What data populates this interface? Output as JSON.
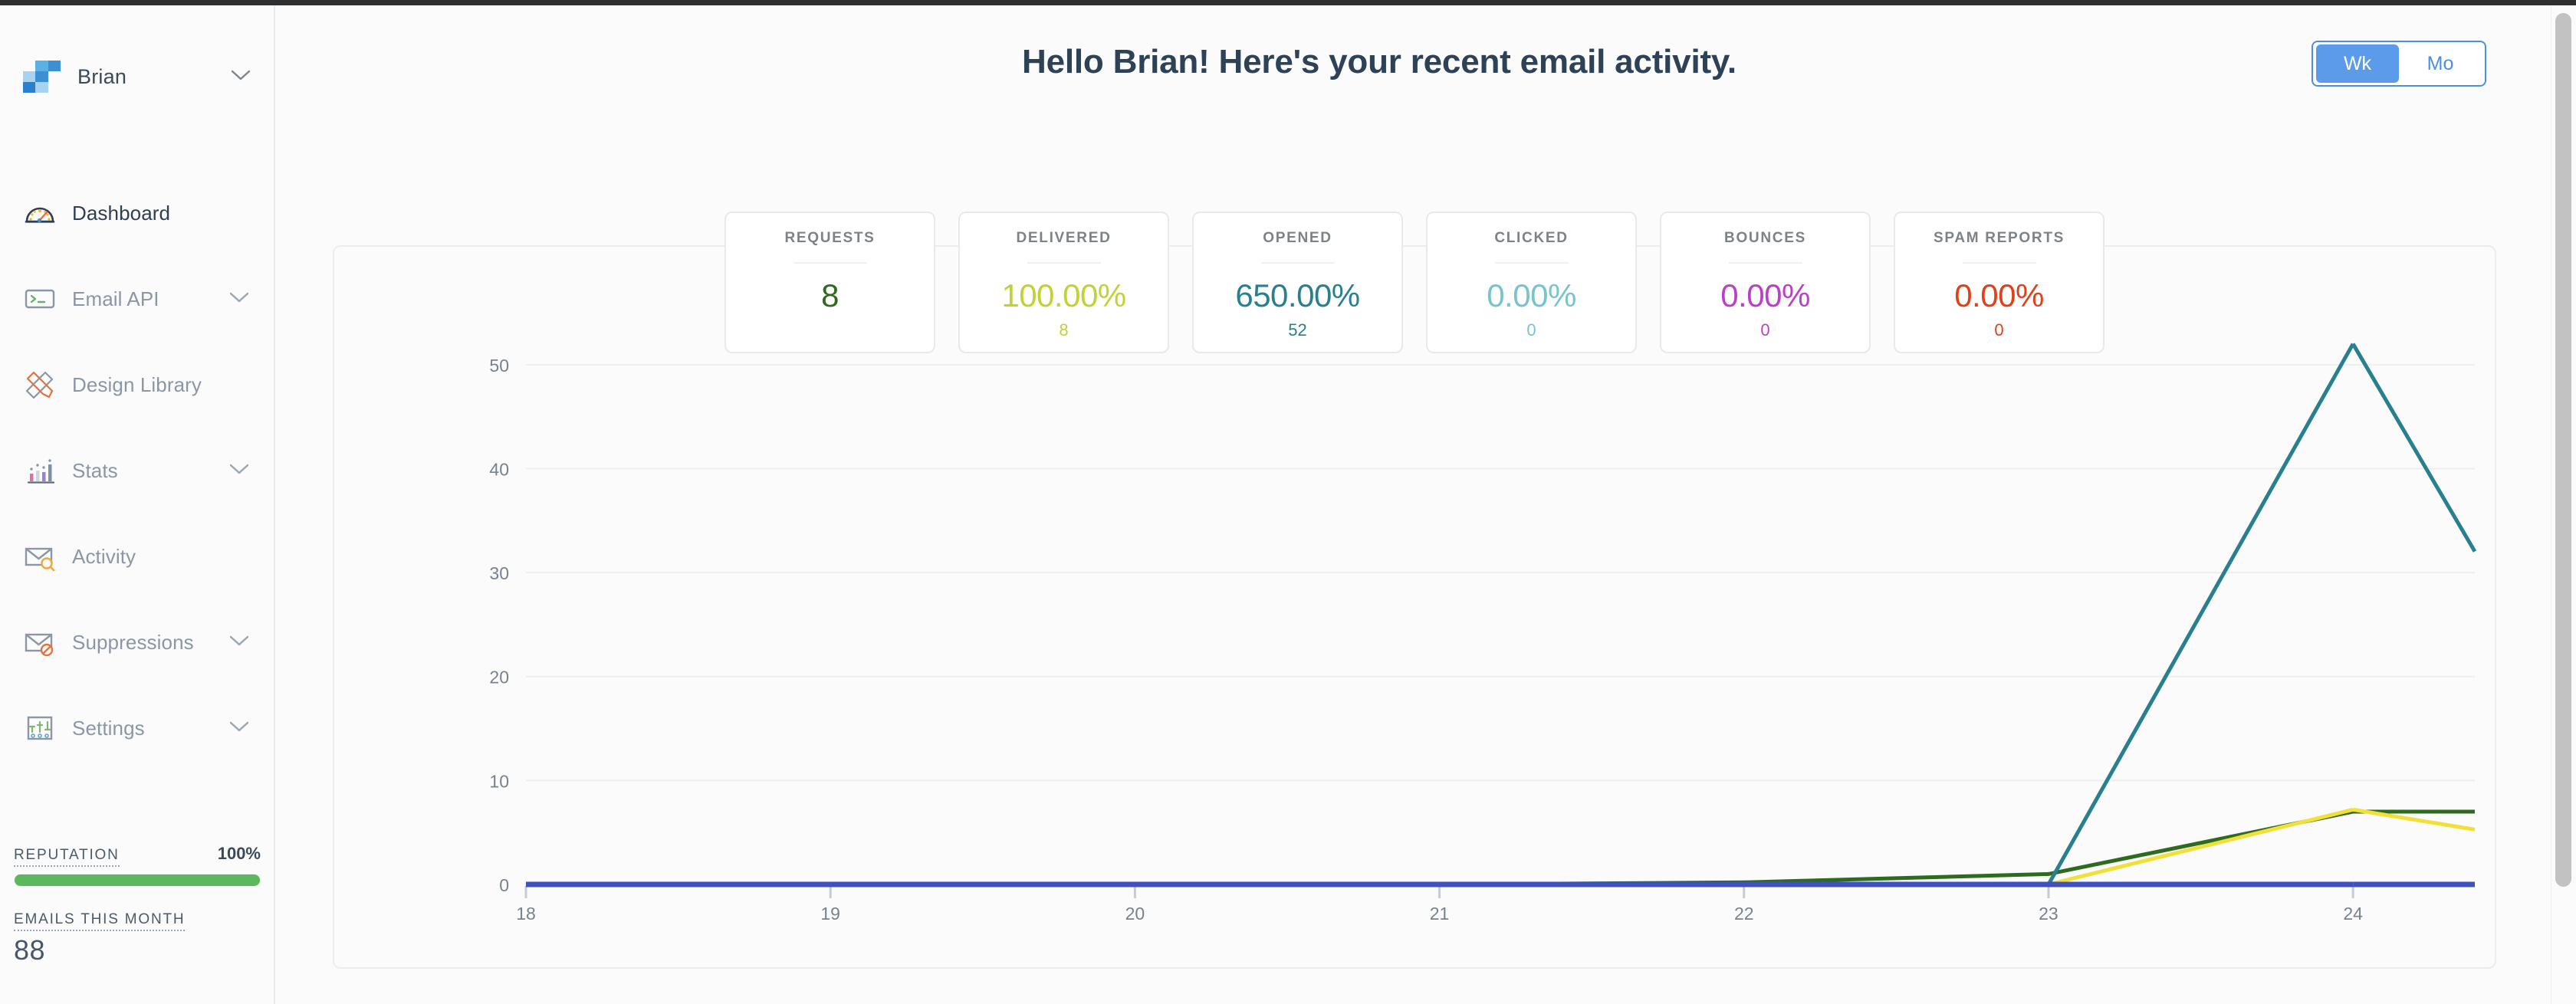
{
  "brand": {
    "name": "Brian",
    "logo_icon": "sendgrid-logo-icon",
    "caret_icon": "chevron-down-icon"
  },
  "sidebar": {
    "items": [
      {
        "label": "Dashboard",
        "icon": "speedometer-icon",
        "active": true,
        "caret": false
      },
      {
        "label": "Email API",
        "icon": "terminal-card-icon",
        "active": false,
        "caret": true
      },
      {
        "label": "Design Library",
        "icon": "ruler-pencil-icon",
        "active": false,
        "caret": false
      },
      {
        "label": "Stats",
        "icon": "bar-chart-icon",
        "active": false,
        "caret": true
      },
      {
        "label": "Activity",
        "icon": "envelope-search-icon",
        "active": false,
        "caret": false
      },
      {
        "label": "Suppressions",
        "icon": "envelope-block-icon",
        "active": false,
        "caret": true
      },
      {
        "label": "Settings",
        "icon": "sliders-icon",
        "active": false,
        "caret": true
      }
    ],
    "reputation": {
      "label": "REPUTATION",
      "value": "100%",
      "percent": 100,
      "bar_color": "#5cb85c"
    },
    "emails_this_month": {
      "label": "EMAILS THIS MONTH",
      "value": "88"
    }
  },
  "header": {
    "title": "Hello Brian! Here's your recent email activity.",
    "range_toggle": {
      "options": [
        {
          "label": "Wk",
          "active": true
        },
        {
          "label": "Mo",
          "active": false
        }
      ],
      "accent": "#4a90e2"
    }
  },
  "metrics": [
    {
      "title": "REQUESTS",
      "main": "8",
      "sub": "",
      "color": "#2f6b1e"
    },
    {
      "title": "DELIVERED",
      "main": "100.00%",
      "sub": "8",
      "color": "#c2d135"
    },
    {
      "title": "OPENED",
      "main": "650.00%",
      "sub": "52",
      "color": "#28808f"
    },
    {
      "title": "CLICKED",
      "main": "0.00%",
      "sub": "0",
      "color": "#78c3cd"
    },
    {
      "title": "BOUNCES",
      "main": "0.00%",
      "sub": "0",
      "color": "#bb3fc9"
    },
    {
      "title": "SPAM REPORTS",
      "main": "0.00%",
      "sub": "0",
      "color": "#e0401a"
    }
  ],
  "chart_data": {
    "type": "line",
    "title": "",
    "xlabel": "",
    "ylabel": "",
    "x": [
      18,
      19,
      20,
      21,
      22,
      23,
      24
    ],
    "xticklabels": [
      "18",
      "19",
      "20",
      "21",
      "22",
      "23",
      "24"
    ],
    "yticklabels": [
      "0",
      "10",
      "20",
      "30",
      "40",
      "50"
    ],
    "ylim": [
      0,
      55
    ],
    "xlim": [
      18,
      24.4
    ],
    "grid": true,
    "legend": "none",
    "series": [
      {
        "name": "Requests",
        "color": "#2f6b1e",
        "values": [
          0,
          0,
          0,
          0,
          0.2,
          1.0,
          7.0
        ]
      },
      {
        "name": "Delivered",
        "color": "#f2e03a",
        "values": [
          0,
          0,
          0,
          0,
          0,
          0,
          7.2
        ]
      },
      {
        "name": "Opened",
        "color": "#28808f",
        "values": [
          0,
          0,
          0,
          0,
          0,
          0,
          52.0
        ]
      },
      {
        "name": "Clicked",
        "color": "#3f51c0",
        "values": [
          0,
          0,
          0,
          0,
          0,
          0,
          0
        ]
      }
    ]
  }
}
